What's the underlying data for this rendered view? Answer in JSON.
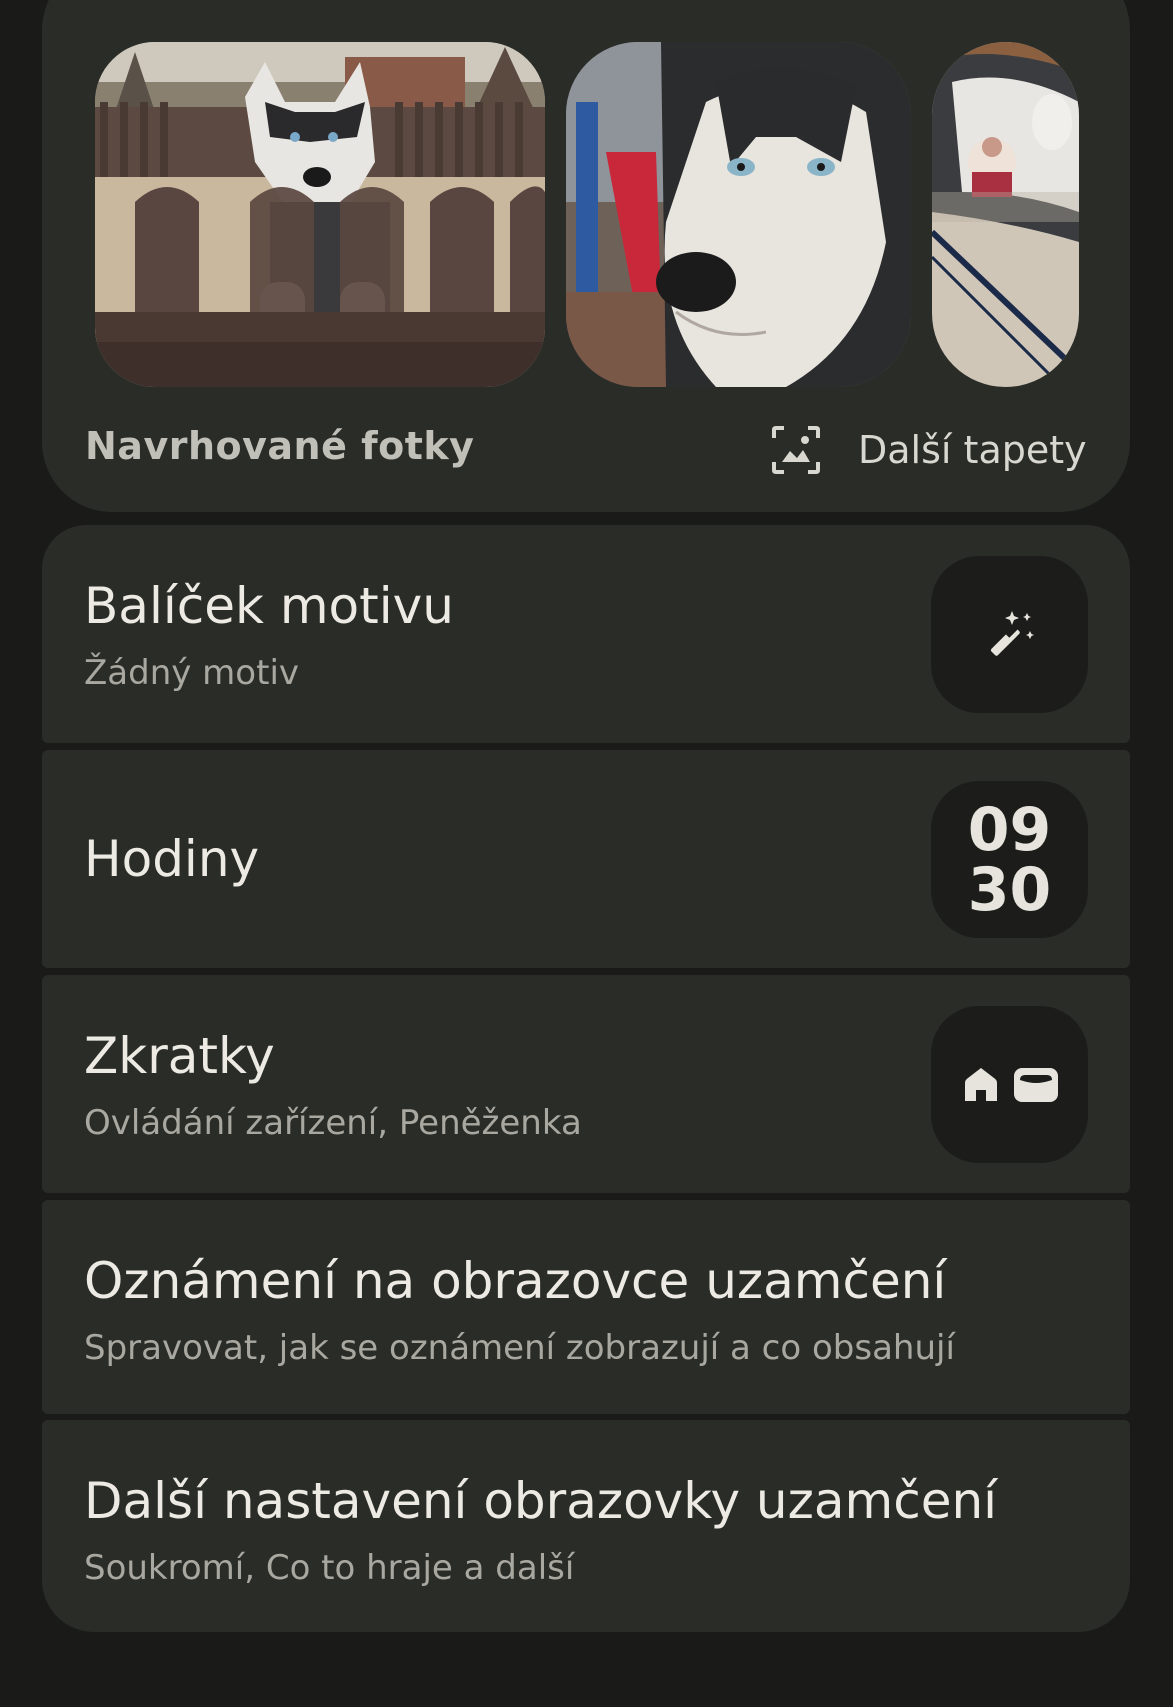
{
  "wallpaper": {
    "photos": [
      "husky-at-fence",
      "husky-closeup",
      "husky-lying-with-toy"
    ],
    "suggested_label": "Navrhované fotky",
    "more_label": "Další tapety",
    "more_icon": "wallpaper-icon"
  },
  "settings": {
    "theme_pack": {
      "title": "Balíček motivu",
      "subtitle": "Žádný motiv",
      "icon": "magic-wand-icon"
    },
    "clock": {
      "title": "Hodiny",
      "preview_hours": "09",
      "preview_minutes": "30"
    },
    "shortcuts": {
      "title": "Zkratky",
      "subtitle": "Ovládání zařízení, Peněženka",
      "icons": [
        "home-icon",
        "wallet-icon"
      ]
    },
    "lock_notifications": {
      "title": "Oznámení na obrazovce uzamčení",
      "subtitle": "Spravovat, jak se oznámení zobrazují a co obsahují"
    },
    "more_lock_settings": {
      "title": "Další nastavení obrazovky uzamčení",
      "subtitle": "Soukromí, Co to hraje a další"
    }
  },
  "colors": {
    "background": "#1a1b18",
    "card": "#2a2c28",
    "tile": "#1c1d1a",
    "text_primary": "#eceae3",
    "text_secondary": "#a9a8a0"
  }
}
